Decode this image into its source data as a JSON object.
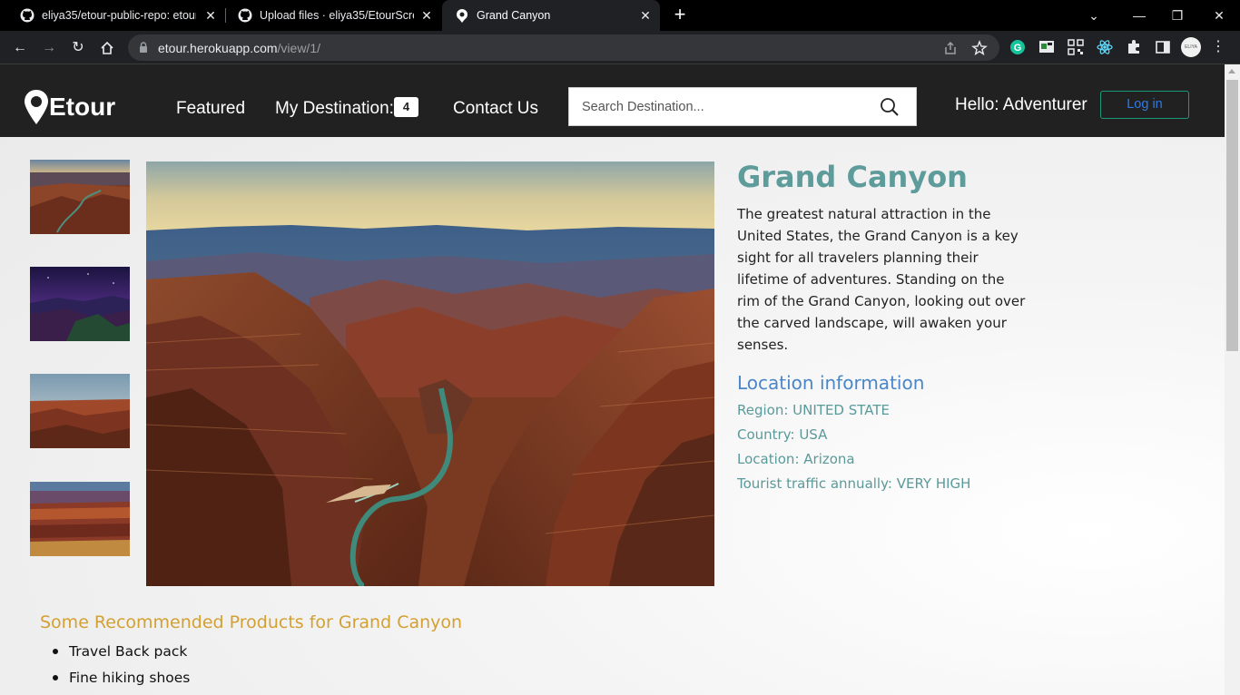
{
  "browser": {
    "tabs": [
      {
        "title": "eliya35/etour-public-repo: etour",
        "icon": "github-icon"
      },
      {
        "title": "Upload files · eliya35/EtourScreen",
        "icon": "github-icon"
      },
      {
        "title": "Grand Canyon",
        "icon": "etour-pin-icon",
        "active": true
      }
    ],
    "url_host": "etour.herokuapp.com",
    "url_path": "/view/1/"
  },
  "nav": {
    "logo_text": "Etour",
    "links": [
      "Featured",
      "My Destination:",
      "Contact Us"
    ],
    "destination_count": "4",
    "search_placeholder": "Search Destination...",
    "greeting": "Hello: Adventurer",
    "login_label": "Log in"
  },
  "destination": {
    "title": "Grand Canyon",
    "description": "The greatest natural attraction in the United States, the Grand Canyon is a key sight for all travelers planning their lifetime of adventures. Standing on the rim of the Grand Canyon, looking out over the carved landscape, will awaken your senses.",
    "location_heading": "Location information",
    "region": "Region: UNITED STATE",
    "country": "Country: USA",
    "location": "Location: Arizona",
    "traffic": "Tourist traffic annually: VERY HIGH"
  },
  "recommendations": {
    "heading": "Some Recommended Products for Grand Canyon",
    "items": [
      "Travel Back pack",
      "Fine hiking shoes"
    ]
  },
  "colors": {
    "nav_bg": "#212121",
    "title": "#5e9b9b",
    "heading_blue": "#4a86c8",
    "reco_gold": "#d3a033",
    "login_border": "#1b9a79"
  }
}
